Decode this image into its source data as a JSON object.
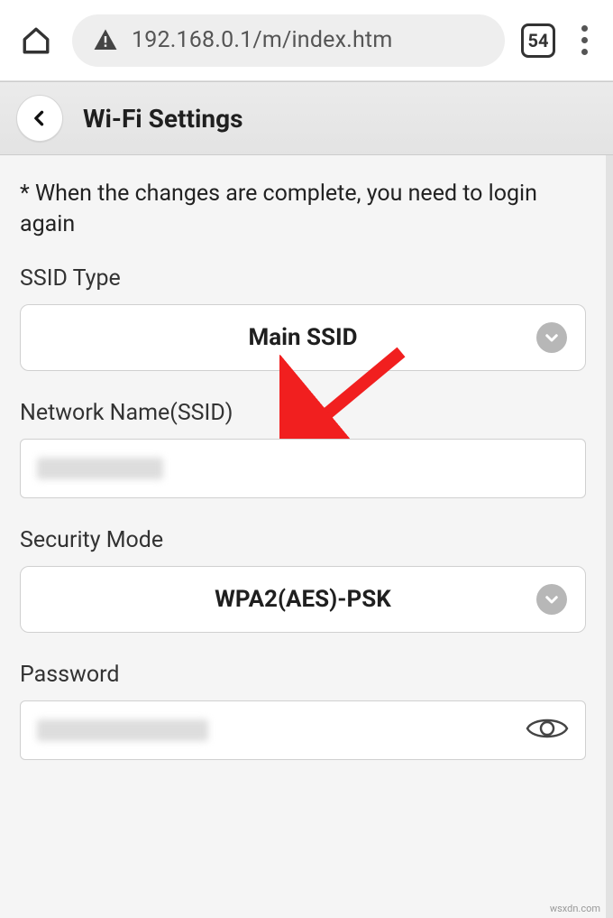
{
  "browser": {
    "url": "192.168.0.1/m/index.htm",
    "tab_count": "54"
  },
  "header": {
    "title": "Wi-Fi Settings"
  },
  "notice": "* When the changes are complete, you need to login again",
  "fields": {
    "ssid_type": {
      "label": "SSID Type",
      "value": "Main SSID"
    },
    "network_name": {
      "label": "Network Name(SSID)",
      "value": ""
    },
    "security_mode": {
      "label": "Security Mode",
      "value": "WPA2(AES)-PSK"
    },
    "password": {
      "label": "Password",
      "value": ""
    }
  },
  "watermark": "wsxdn.com"
}
